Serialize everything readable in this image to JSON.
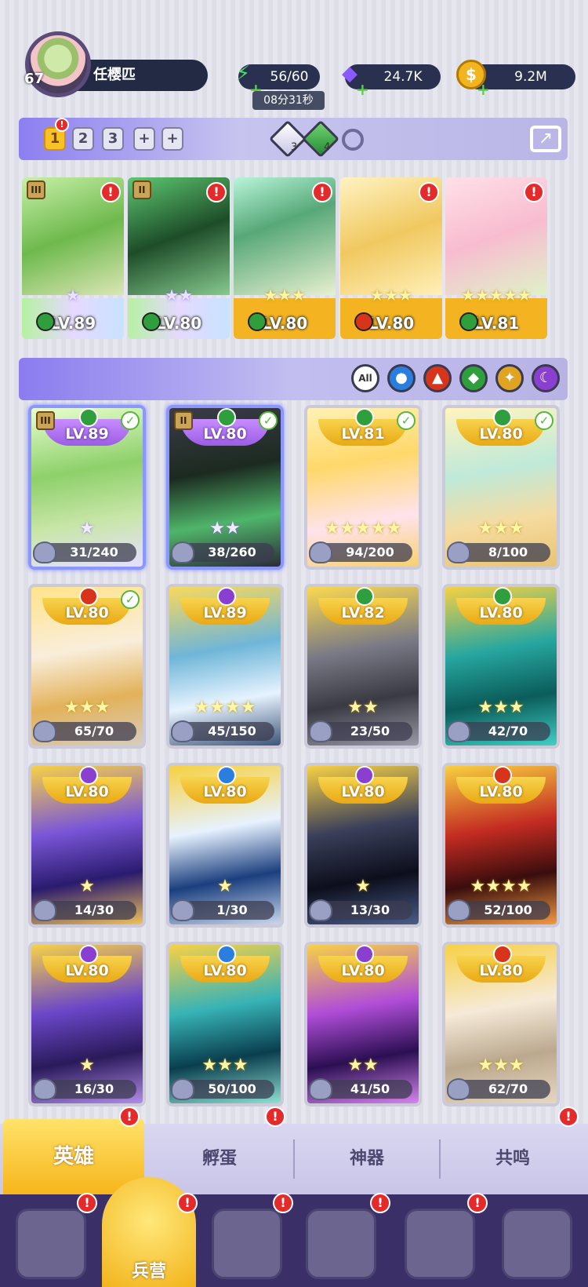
{
  "player": {
    "level": "67",
    "name": "任樱匹"
  },
  "resources": {
    "energy": "56/60",
    "energy_timer": "08分31秒",
    "gems": "24.7K",
    "coins": "9.2M"
  },
  "team_tabs": [
    "1",
    "2",
    "3",
    "+",
    "+"
  ],
  "team_gems": {
    "white_count": "3",
    "green_count": "4"
  },
  "lineup": [
    {
      "level": "LV.89",
      "stars": "★",
      "element": "nature",
      "rank": "III"
    },
    {
      "level": "LV.80",
      "stars": "★★",
      "element": "nature",
      "rank": "II"
    },
    {
      "level": "LV.80",
      "stars": "★★★",
      "element": "nature",
      "rank": ""
    },
    {
      "level": "LV.80",
      "stars": "★★★",
      "element": "fire",
      "rank": ""
    },
    {
      "level": "LV.81",
      "stars": "★★★★★",
      "element": "nature",
      "rank": ""
    }
  ],
  "filter": {
    "all_label": "All",
    "elements": [
      "water",
      "fire",
      "nature",
      "light",
      "dark"
    ]
  },
  "heroes": [
    {
      "level": "LV.89",
      "progress": "31/240",
      "stars": "★",
      "element": "nature"
    },
    {
      "level": "LV.80",
      "progress": "38/260",
      "stars": "★★",
      "element": "nature"
    },
    {
      "level": "LV.81",
      "progress": "94/200",
      "stars": "★★★★★",
      "element": "nature"
    },
    {
      "level": "LV.80",
      "progress": "8/100",
      "stars": "★★★",
      "element": "nature"
    },
    {
      "level": "LV.80",
      "progress": "65/70",
      "stars": "★★★",
      "element": "fire"
    },
    {
      "level": "LV.89",
      "progress": "45/150",
      "stars": "★★★★",
      "element": "dark"
    },
    {
      "level": "LV.82",
      "progress": "23/50",
      "stars": "★★",
      "element": "nature"
    },
    {
      "level": "LV.80",
      "progress": "42/70",
      "stars": "★★★",
      "element": "nature"
    },
    {
      "level": "LV.80",
      "progress": "14/30",
      "stars": "★",
      "element": "dark"
    },
    {
      "level": "LV.80",
      "progress": "1/30",
      "stars": "★",
      "element": "water"
    },
    {
      "level": "LV.80",
      "progress": "13/30",
      "stars": "★",
      "element": "dark"
    },
    {
      "level": "LV.80",
      "progress": "52/100",
      "stars": "★★★★",
      "element": "fire"
    },
    {
      "level": "LV.80",
      "progress": "16/30",
      "stars": "★",
      "element": "dark"
    },
    {
      "level": "LV.80",
      "progress": "50/100",
      "stars": "★★★",
      "element": "water"
    },
    {
      "level": "LV.80",
      "progress": "41/50",
      "stars": "★★",
      "element": "dark"
    },
    {
      "level": "LV.80",
      "progress": "62/70",
      "stars": "★★★",
      "element": "fire"
    }
  ],
  "tabs": [
    "英雄",
    "孵蛋",
    "神器",
    "共鸣"
  ],
  "nav": {
    "active_label": "兵营"
  },
  "colors": {
    "nature": "#2f9e3c",
    "fire": "#d8341c",
    "water": "#2a7ee0",
    "dark": "#8a3fd1",
    "light": "#e0a423",
    "gold": "#f6be26"
  }
}
